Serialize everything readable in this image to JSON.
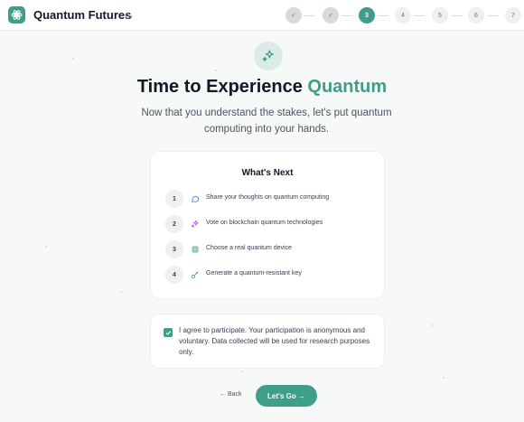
{
  "header": {
    "app_title": "Quantum Futures",
    "logo_icon": "atom-icon",
    "theme_icon": "moon-icon"
  },
  "progress": {
    "current_step": 3,
    "steps": [
      {
        "label": "✓",
        "state": "done"
      },
      {
        "label": "✓",
        "state": "done"
      },
      {
        "label": "3",
        "state": "current"
      },
      {
        "label": "4",
        "state": "upcoming"
      },
      {
        "label": "5",
        "state": "upcoming"
      },
      {
        "label": "6",
        "state": "upcoming"
      },
      {
        "label": "7",
        "state": "upcoming"
      }
    ]
  },
  "hero": {
    "icon": "sparkles-icon",
    "title_prefix": "Time to Experience ",
    "title_accent": "Quantum",
    "subtitle": "Now that you understand the stakes, let's put quantum computing into your hands."
  },
  "next_card": {
    "title": "What's Next",
    "items": [
      {
        "number": "1",
        "icon": "chat-bubble-icon",
        "label": "Share your thoughts on quantum computing"
      },
      {
        "number": "2",
        "icon": "sparkles-icon",
        "label": "Vote on blockchain quantum technologies"
      },
      {
        "number": "3",
        "icon": "chip-icon",
        "label": "Choose a real quantum device"
      },
      {
        "number": "4",
        "icon": "key-icon",
        "label": "Generate a quantum-resistant key"
      }
    ]
  },
  "consent": {
    "checked": true,
    "text": "I agree to participate. Your participation is anonymous and voluntary. Data collected will be used for research purposes only."
  },
  "footer": {
    "back_label": "← Back",
    "go_label": "Let's Go →"
  },
  "colors": {
    "accent": "#3f9e8a",
    "purple_icon": "#a855f7",
    "blue_icon": "#3b82f6"
  }
}
